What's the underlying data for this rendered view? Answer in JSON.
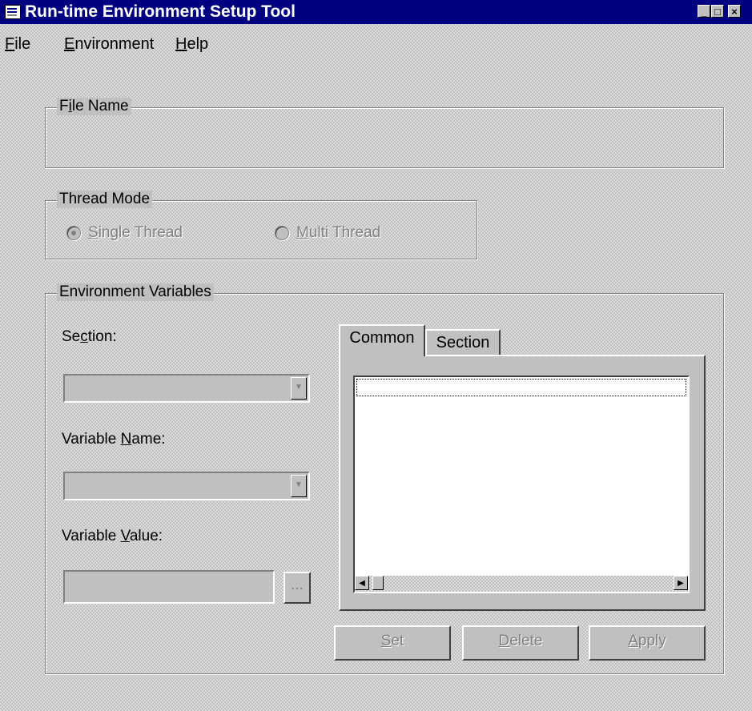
{
  "window": {
    "title": "Run-time Environment Setup Tool",
    "title_bar_color": "#000080",
    "minimize_glyph": "_",
    "maximize_glyph": "□",
    "close_glyph": "×"
  },
  "menu": [
    {
      "mnemonic": "F",
      "rest": "ile"
    },
    {
      "mnemonic": "E",
      "rest": "nvironment"
    },
    {
      "mnemonic": "H",
      "rest": "elp"
    }
  ],
  "file_name_group": {
    "legend_pre": "F",
    "legend_mnemonic": "i",
    "legend_post": "le Name",
    "value": ""
  },
  "thread_mode_group": {
    "legend": "Thread Mode",
    "single": {
      "mnemonic": "S",
      "rest": "ingle Thread",
      "checked": true
    },
    "multi": {
      "mnemonic": "M",
      "rest": "ulti Thread",
      "checked": false
    }
  },
  "env_vars_group": {
    "legend": "Environment Variables",
    "section_label_pre": "Se",
    "section_label_mnemonic": "c",
    "section_label_post": "tion:",
    "section_value": "",
    "variable_name_label_pre": "Variable ",
    "variable_name_label_mnemonic": "N",
    "variable_name_label_post": "ame:",
    "variable_name_value": "",
    "variable_value_label_pre": "Variable ",
    "variable_value_label_mnemonic": "V",
    "variable_value_label_post": "alue:",
    "variable_value_value": "",
    "browse_label": "...",
    "tabs": [
      "Common",
      "Section"
    ],
    "active_tab": "Common",
    "list_items": []
  },
  "buttons": {
    "set": {
      "mnemonic": "S",
      "rest": "et",
      "enabled": false
    },
    "delete": {
      "mnemonic": "D",
      "rest": "elete",
      "enabled": false
    },
    "apply": {
      "mnemonic": "A",
      "rest": "pply",
      "enabled": false
    }
  },
  "icons": {
    "app": "app-window-icon",
    "combo_arrow": "chevron-down-icon",
    "scroll_left": "arrow-left-icon",
    "scroll_right": "arrow-right-icon"
  }
}
